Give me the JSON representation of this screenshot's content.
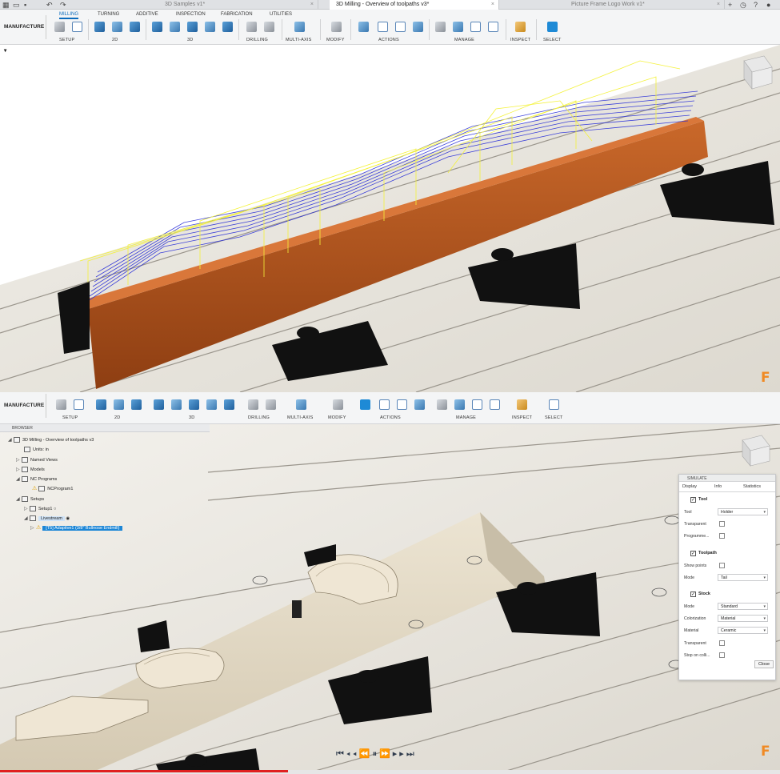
{
  "titlebar": {
    "tabs": [
      {
        "label": "3D Samples v1*",
        "active": false
      },
      {
        "label": "3D Milling - Overview of toolpaths v3*",
        "active": true
      },
      {
        "label": "Picture Frame Logo Work v1*",
        "active": false
      }
    ]
  },
  "ribbon": {
    "workspace": "MANUFACTURE",
    "tabs": [
      "MILLING",
      "TURNING",
      "ADDITIVE",
      "INSPECTION",
      "FABRICATION",
      "UTILITIES"
    ],
    "active_tab": "MILLING",
    "groups": [
      "SETUP",
      "2D",
      "3D",
      "DRILLING",
      "MULTI-AXIS",
      "MODIFY",
      "ACTIONS",
      "MANAGE",
      "INSPECT",
      "SELECT"
    ]
  },
  "browser": {
    "title": "BROWSER",
    "items": [
      {
        "label": "3D Milling - Overview of toolpaths v3"
      },
      {
        "label": "Units: in"
      },
      {
        "label": "Named Views"
      },
      {
        "label": "Models"
      },
      {
        "label": "NC Programs"
      },
      {
        "label": "NCProgram1"
      },
      {
        "label": "Setups"
      },
      {
        "label": "Setup1"
      },
      {
        "label": "Livestream"
      },
      {
        "label": "[T5] Adaptive1 (3/8\" Bullnose Endmill)"
      }
    ]
  },
  "simulate": {
    "title": "SIMULATE",
    "tabs": [
      "Display",
      "Info",
      "Statistics"
    ],
    "sections": {
      "tool": {
        "title": "Tool",
        "tool_label": "Tool",
        "tool_value": "Holder",
        "transparent_label": "Transparent",
        "programmed_label": "Programme..."
      },
      "toolpath": {
        "title": "Toolpath",
        "show_points_label": "Show points",
        "mode_label": "Mode",
        "mode_value": "Tail"
      },
      "stock": {
        "title": "Stock",
        "mode_label": "Mode",
        "mode_value": "Standard",
        "colorization_label": "Colorization",
        "colorization_value": "Material",
        "material_label": "Material",
        "material_value": "Ceramic",
        "transparent_label": "Transparent",
        "stop_label": "Stop on colli..."
      }
    },
    "close_label": "Close"
  },
  "colors": {
    "accent": "#1c86d6",
    "stock_orange": "#b85a23",
    "toolpath_yellow": "#f4f23a",
    "toolpath_blue": "#2a2fd8"
  }
}
